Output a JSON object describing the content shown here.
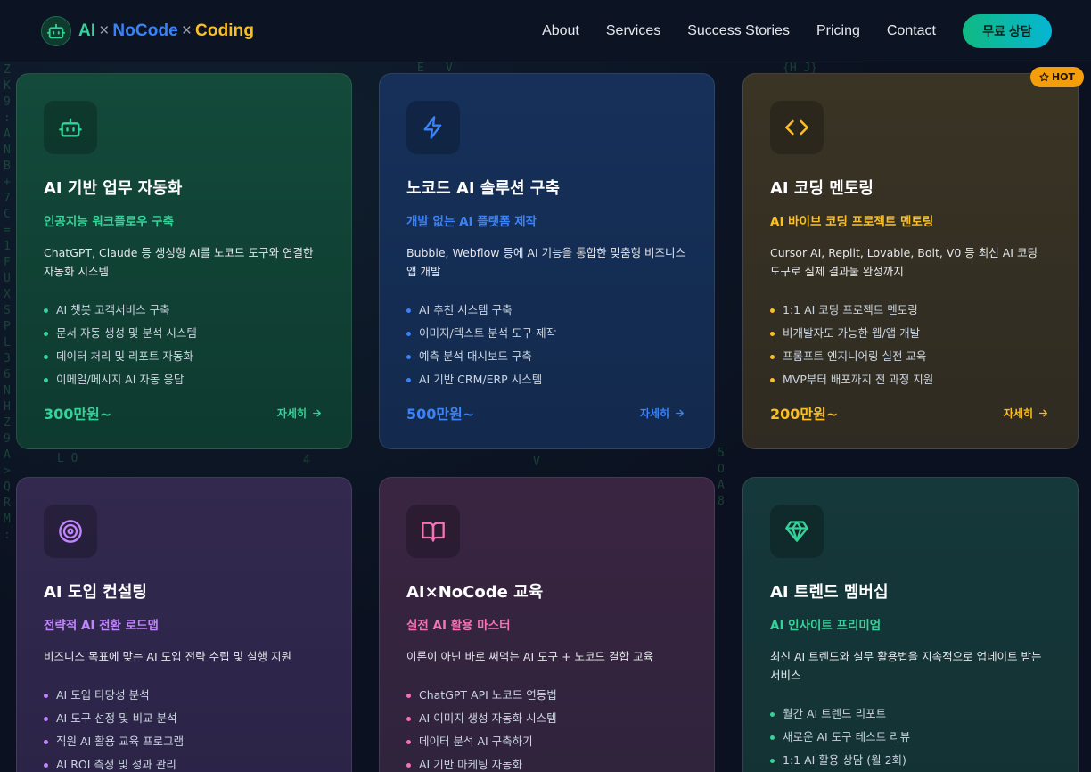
{
  "header": {
    "brand": {
      "ai": "AI",
      "x1": "×",
      "nocode": "NoCode",
      "x2": "×",
      "coding": "Coding"
    },
    "nav": [
      "About",
      "Services",
      "Success Stories",
      "Pricing",
      "Contact"
    ],
    "cta": "무료 상담"
  },
  "badge": {
    "hot": "HOT",
    "icon": "star-icon"
  },
  "colors": {
    "green": "#34d399",
    "blue": "#3b82f6",
    "amber": "#fbbf24",
    "violet": "#c084fc",
    "pink": "#f472b6",
    "accent_cta": "#10b981"
  },
  "cards": [
    {
      "icon": "robot-icon",
      "title": "AI 기반 업무 자동화",
      "subtitle": "인공지능 워크플로우 구축",
      "desc": "ChatGPT, Claude 등 생성형 AI를 노코드 도구와 연결한 자동화 시스템",
      "items": [
        "AI 챗봇 고객서비스 구축",
        "문서 자동 생성 및 분석 시스템",
        "데이터 처리 및 리포트 자동화",
        "이메일/메시지 AI 자동 응답"
      ],
      "price": "300만원~",
      "more": "자세히"
    },
    {
      "icon": "lightning-icon",
      "title": "노코드 AI 솔루션 구축",
      "subtitle": "개발 없는 AI 플랫폼 제작",
      "desc": "Bubble, Webflow 등에 AI 기능을 통합한 맞춤형 비즈니스 앱 개발",
      "items": [
        "AI 추천 시스템 구축",
        "이미지/텍스트 분석 도구 제작",
        "예측 분석 대시보드 구축",
        "AI 기반 CRM/ERP 시스템"
      ],
      "price": "500만원~",
      "more": "자세히"
    },
    {
      "icon": "code-icon",
      "title": "AI 코딩 멘토링",
      "subtitle": "AI 바이브 코딩 프로젝트 멘토링",
      "desc": "Cursor AI, Replit, Lovable, Bolt, V0 등 최신 AI 코딩 도구로 실제 결과물 완성까지",
      "items": [
        "1:1 AI 코딩 프로젝트 멘토링",
        "비개발자도 가능한 웹/앱 개발",
        "프롬프트 엔지니어링 실전 교육",
        "MVP부터 배포까지 전 과정 지원"
      ],
      "price": "200만원~",
      "more": "자세히"
    },
    {
      "icon": "target-icon",
      "title": "AI 도입 컨설팅",
      "subtitle": "전략적 AI 전환 로드맵",
      "desc": "비즈니스 목표에 맞는 AI 도입 전략 수립 및 실행 지원",
      "items": [
        "AI 도입 타당성 분석",
        "AI 도구 선정 및 비교 분석",
        "직원 AI 활용 교육 프로그램",
        "AI ROI 측정 및 성과 관리"
      ]
    },
    {
      "icon": "book-icon",
      "title": "AI×NoCode 교육",
      "subtitle": "실전 AI 활용 마스터",
      "desc": "이론이 아닌 바로 써먹는 AI 도구 + 노코드 결합 교육",
      "items": [
        "ChatGPT API 노코드 연동법",
        "AI 이미지 생성 자동화 시스템",
        "데이터 분석 AI 구축하기",
        "AI 기반 마케팅 자동화"
      ]
    },
    {
      "icon": "diamond-icon",
      "title": "AI 트렌드 멤버십",
      "subtitle": "AI 인사이트 프리미엄",
      "desc": "최신 AI 트렌드와 실무 활용법을 지속적으로 업데이트 받는 서비스",
      "items": [
        "월간 AI 트렌드 리포트",
        "새로운 AI 도구 테스트 리뷰",
        "1:1 AI 활용 상담 (월 2회)"
      ]
    }
  ]
}
